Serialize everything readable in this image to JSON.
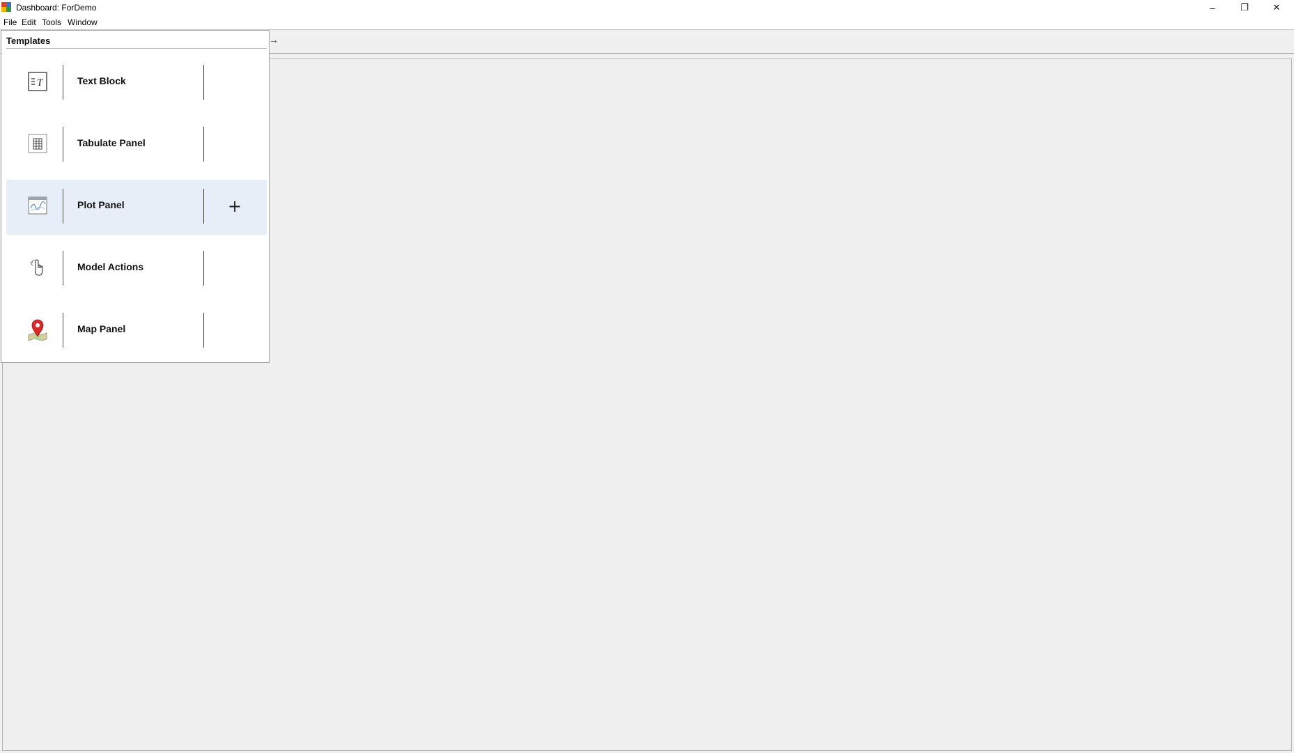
{
  "window": {
    "title": "Dashboard: ForDemo",
    "minimize": "–",
    "restore": "❐",
    "close": "✕"
  },
  "menu": {
    "file": "File",
    "edit": "Edit",
    "tools": "Tools",
    "window": "Window"
  },
  "toolbar": {
    "arrow": "→"
  },
  "templates": {
    "header": "Templates",
    "items": [
      {
        "label": "Text Block",
        "icon": "text-block-icon"
      },
      {
        "label": "Tabulate Panel",
        "icon": "table-icon"
      },
      {
        "label": "Plot Panel",
        "icon": "plot-icon",
        "add": "+"
      },
      {
        "label": "Model Actions",
        "icon": "hand-pointer-icon"
      },
      {
        "label": "Map Panel",
        "icon": "map-pin-icon"
      }
    ]
  },
  "colors": {
    "hover_row": "#e8eef8",
    "map_pin": "#d62b2b",
    "workspace": "#f0f0f0"
  }
}
